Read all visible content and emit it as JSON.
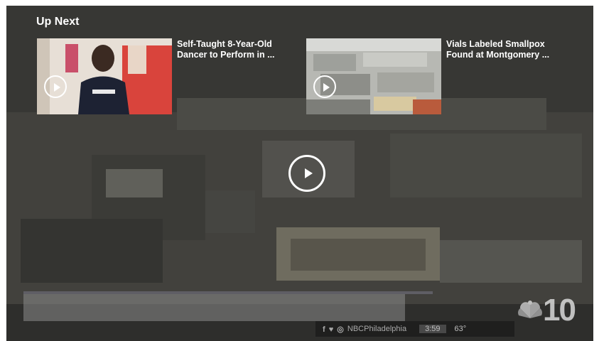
{
  "up_next": {
    "heading": "Up Next",
    "items": [
      {
        "title": "Self-Taught 8-Year-Old Dancer to Perform in ..."
      },
      {
        "title": "Vials Labeled Smallpox Found at Montgomery ..."
      }
    ]
  },
  "lower_third": {
    "social_icons": "f ♥ ◎",
    "handle": "NBCPhiladelphia",
    "time": "3:59",
    "temperature": "63°"
  },
  "logo": {
    "number": "10",
    "icon": "nbc-peacock-icon"
  },
  "colors": {
    "overlay": "#3a3a36",
    "text": "#ffffff",
    "ticker_text": "#a9a9a9"
  }
}
